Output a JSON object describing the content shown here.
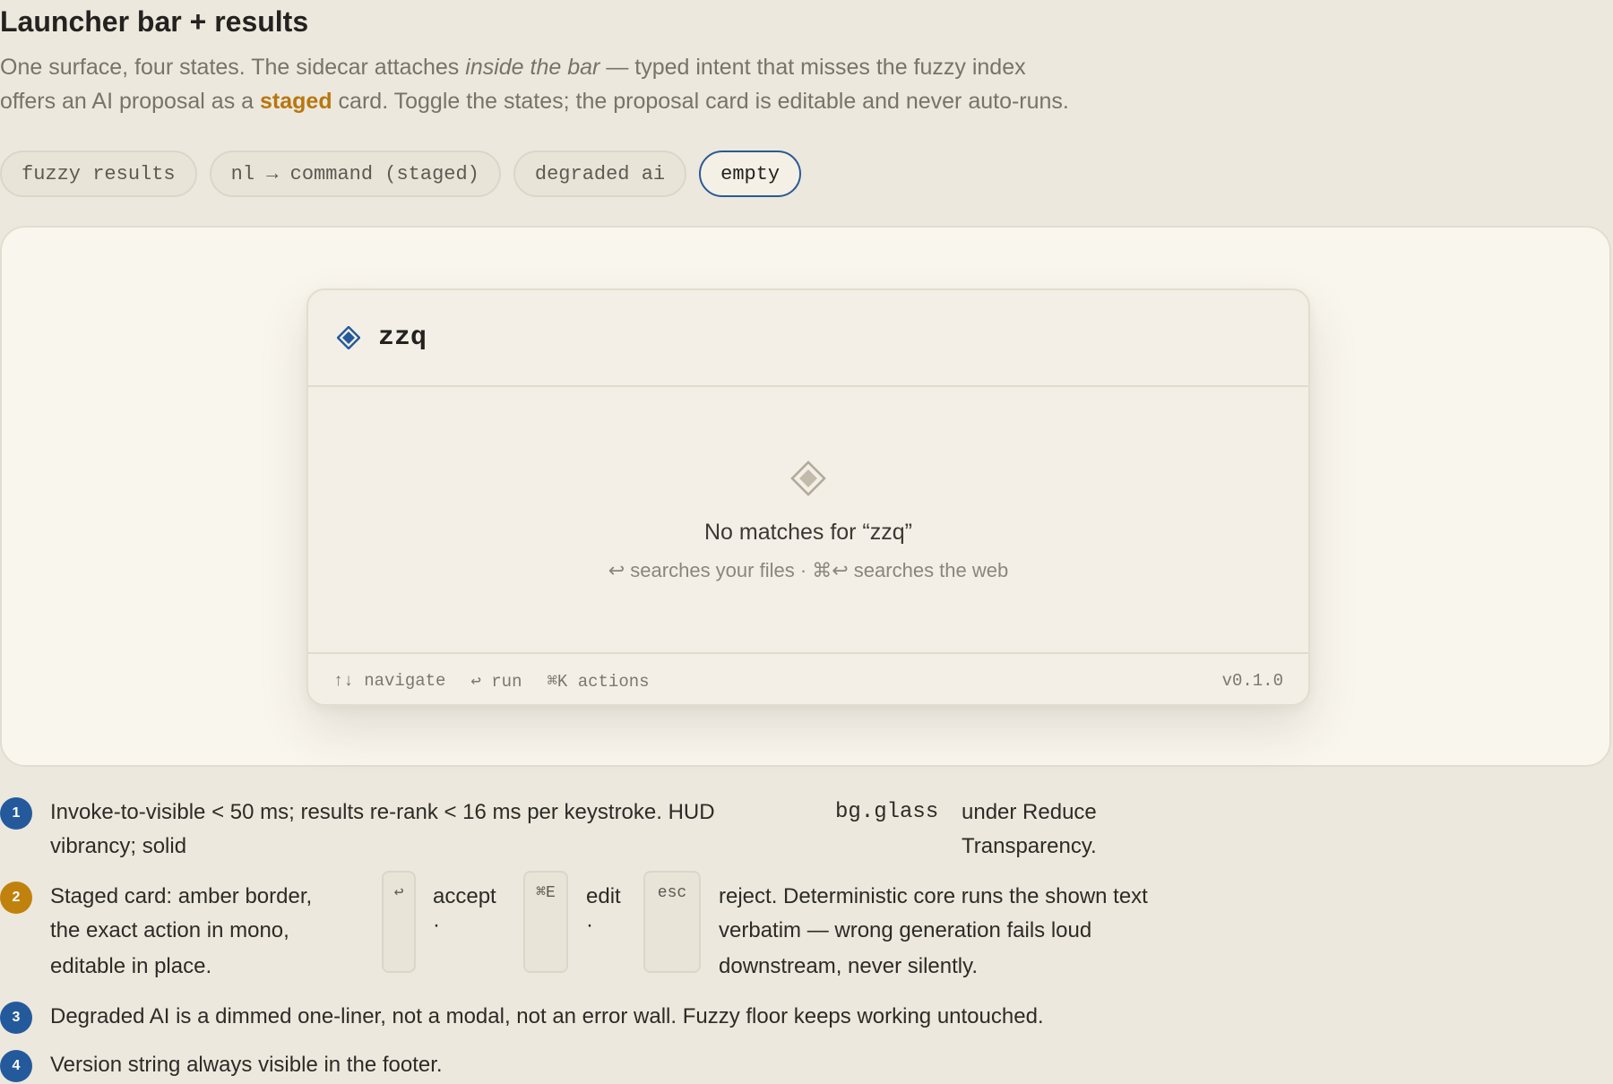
{
  "header": {
    "title": "Launcher bar + results",
    "intro_1": "One surface, four states. The sidecar attaches ",
    "intro_em": "inside the bar",
    "intro_2": " — typed intent that misses the fuzzy index",
    "intro_3": "offers an AI proposal as a ",
    "intro_staged": "staged",
    "intro_4": " card. Toggle the states; the proposal card is editable and never auto-runs."
  },
  "tabs": [
    {
      "label": "fuzzy results",
      "active": false
    },
    {
      "label": "nl → command (staged)",
      "active": false
    },
    {
      "label": "degraded ai",
      "active": false
    },
    {
      "label": "empty",
      "active": true
    }
  ],
  "launcher": {
    "icon": "diamond-icon",
    "query": "zzq",
    "empty": {
      "icon": "diamond-outline-icon",
      "title": "No matches for “zzq”",
      "hint": "↩ searches your files · ⌘↩ searches the web"
    },
    "footer": {
      "navigate": "↑↓ navigate",
      "run": "↩ run",
      "actions": "⌘K actions",
      "version": "v0.1.0"
    }
  },
  "notes": [
    {
      "num": "1",
      "color": "blue",
      "a": "Invoke-to-visible < 50 ms; results re-rank < 16 ms per keystroke. HUD",
      "b": "vibrancy; solid",
      "code": "bg.glass",
      "c": "under Reduce",
      "d": "Transparency."
    },
    {
      "num": "2",
      "color": "amber",
      "lines": [
        "Staged card: amber border,",
        "the exact action in mono,",
        "editable in place."
      ],
      "keys": [
        {
          "key": "↩",
          "label": "accept",
          "sep": "·"
        },
        {
          "key": "⌘E",
          "label": "edit",
          "sep": "·"
        },
        {
          "key": "esc",
          "label": ""
        }
      ],
      "tail": [
        "reject. Deterministic core runs the shown text",
        "verbatim — wrong generation fails loud",
        "downstream, never silently."
      ]
    },
    {
      "num": "3",
      "color": "blue",
      "text": "Degraded AI is a dimmed one-liner, not a modal, not an error wall. Fuzzy floor keeps working untouched."
    },
    {
      "num": "4",
      "color": "blue",
      "text": "Version string always visible in the footer."
    }
  ],
  "colors": {
    "accent_blue": "#245a9b",
    "staged_amber": "#c0820d",
    "background": "#ece8dd",
    "panel": "#f9f6ee"
  }
}
